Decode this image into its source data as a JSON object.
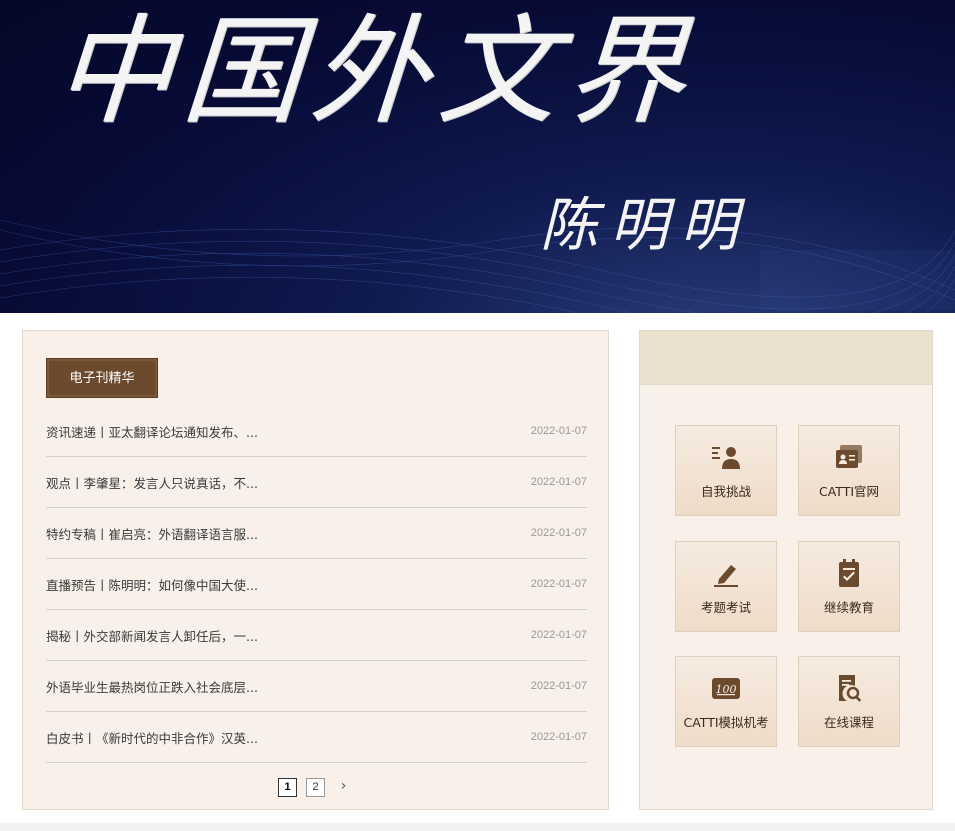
{
  "banner": {
    "title": "中国外文界",
    "author": "陈明明"
  },
  "left_panel": {
    "section_tab": "电子刊精华",
    "news": [
      {
        "title": "资讯速递丨亚太翻译论坛通知发布、...",
        "date": "2022-01-07"
      },
      {
        "title": "观点丨李肇星：发言人只说真话，不...",
        "date": "2022-01-07"
      },
      {
        "title": "特约专稿丨崔启亮：外语翻译语言服...",
        "date": "2022-01-07"
      },
      {
        "title": "直播预告丨陈明明：如何像中国大使...",
        "date": "2022-01-07"
      },
      {
        "title": "揭秘丨外交部新闻发言人卸任后，一...",
        "date": "2022-01-07"
      },
      {
        "title": "外语毕业生最热岗位正跌入社会底层...",
        "date": "2022-01-07"
      },
      {
        "title": "白皮书丨《新时代的中非合作》汉英...",
        "date": "2022-01-07"
      }
    ],
    "pager": {
      "pages": [
        "1",
        "2"
      ],
      "active": "1",
      "next": "›"
    }
  },
  "right_panel": {
    "tiles": [
      {
        "label": "自我挑战",
        "icon": "self-challenge-icon"
      },
      {
        "label": "CATTI官网",
        "icon": "catti-site-icon"
      },
      {
        "label": "考题考试",
        "icon": "exam-pen-icon"
      },
      {
        "label": "继续教育",
        "icon": "clipboard-check-icon"
      },
      {
        "label": "CATTI模拟机考",
        "icon": "score-100-icon"
      },
      {
        "label": "在线课程",
        "icon": "course-search-icon"
      }
    ]
  },
  "colors": {
    "brand_brown": "#6c4a2e",
    "panel_bg": "#f8f0e9",
    "banner_navy": "#070b36"
  }
}
